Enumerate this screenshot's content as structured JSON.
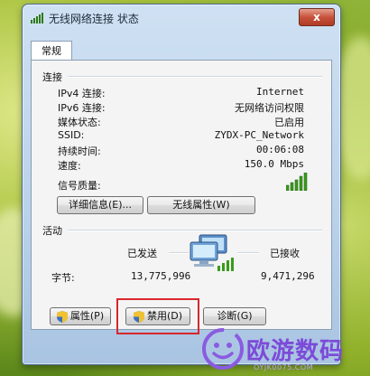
{
  "window": {
    "title": "无线网络连接 状态",
    "close_label": "x"
  },
  "tabs": [
    {
      "label": "常规"
    }
  ],
  "connection": {
    "section_title": "连接",
    "rows": [
      {
        "label": "IPv4 连接:",
        "value": "Internet"
      },
      {
        "label": "IPv6 连接:",
        "value": "无网络访问权限"
      },
      {
        "label": "媒体状态:",
        "value": "已启用"
      },
      {
        "label": "SSID:",
        "value": "ZYDX-PC_Network"
      },
      {
        "label": "持续时间:",
        "value": "00:06:08"
      },
      {
        "label": "速度:",
        "value": "150.0 Mbps"
      }
    ],
    "signal_label": "信号质量:",
    "signal_icon": "signal-bars-icon",
    "details_button": "详细信息(E)...",
    "wireless_props_button": "无线属性(W)"
  },
  "activity": {
    "section_title": "活动",
    "sent_label": "已发送",
    "received_label": "已接收",
    "bytes_label": "字节:",
    "sent_bytes": "13,775,996",
    "received_bytes": "9,471,296",
    "network_icon": "network-computers-icon"
  },
  "buttons": {
    "properties": "属性(P)",
    "disable": "禁用(D)",
    "diagnose": "诊断(G)"
  },
  "accent": {
    "highlight": "#d8262b",
    "signal_green": "#3a9a1c"
  },
  "watermark": {
    "text": "欧游数码",
    "sub": "OYJK0075.COM"
  }
}
